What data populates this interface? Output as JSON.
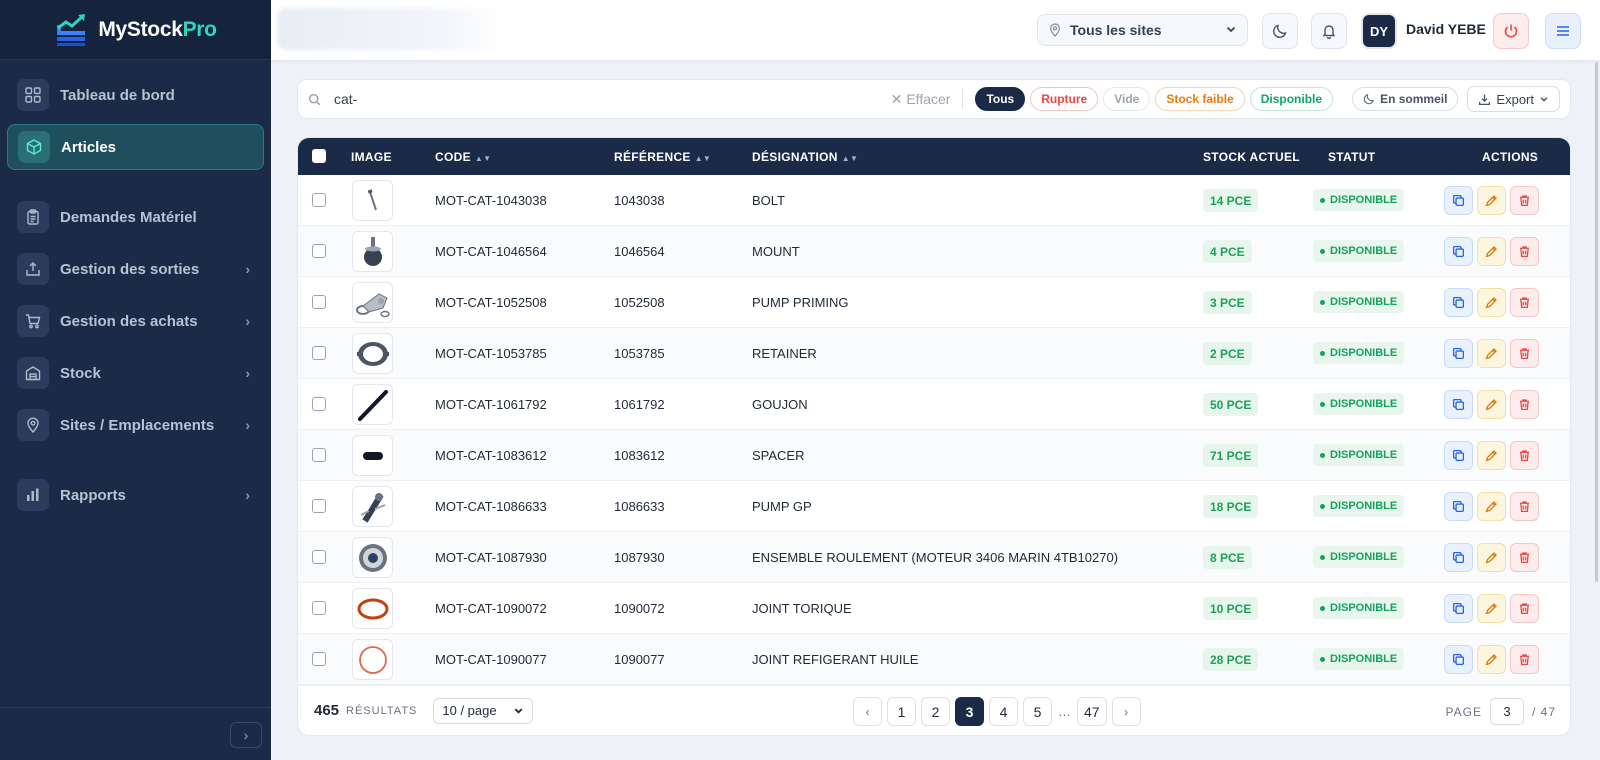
{
  "brand": {
    "name_main": "MyStock",
    "name_accent": "Pro"
  },
  "sidebar": {
    "items": [
      {
        "label": "Tableau de bord",
        "icon": "grid-icon",
        "has_chevron": false
      },
      {
        "label": "Articles",
        "icon": "cube-icon",
        "has_chevron": false,
        "active": true
      },
      {
        "label": "Demandes Matériel",
        "icon": "clipboard-icon",
        "has_chevron": false
      },
      {
        "label": "Gestion des sorties",
        "icon": "upload-icon",
        "has_chevron": true
      },
      {
        "label": "Gestion des achats",
        "icon": "cart-icon",
        "has_chevron": true
      },
      {
        "label": "Stock",
        "icon": "warehouse-icon",
        "has_chevron": true
      },
      {
        "label": "Sites / Emplacements",
        "icon": "map-pin-icon",
        "has_chevron": true
      },
      {
        "label": "Rapports",
        "icon": "bar-chart-icon",
        "has_chevron": true
      }
    ]
  },
  "topbar": {
    "site_select": "Tous les sites",
    "avatar_initials": "DY",
    "user_name": "David YEBE"
  },
  "filters": {
    "search_value": "cat-",
    "clear_label": "Effacer",
    "chips": [
      "Tous",
      "Rupture",
      "Vide",
      "Stock faible",
      "Disponible"
    ],
    "sleep_label": "En sommeil",
    "export_label": "Export"
  },
  "table": {
    "headers": {
      "image": "IMAGE",
      "code": "CODE",
      "reference": "RÉFÉRENCE",
      "designation": "DÉSIGNATION",
      "stock": "STOCK ACTUEL",
      "status": "STATUT",
      "actions": "ACTIONS"
    },
    "rows": [
      {
        "code": "MOT-CAT-1043038",
        "reference": "1043038",
        "designation": "BOLT",
        "stock": "14 PCE",
        "status": "DISPONIBLE",
        "image": "bolt"
      },
      {
        "code": "MOT-CAT-1046564",
        "reference": "1046564",
        "designation": "MOUNT",
        "stock": "4 PCE",
        "status": "DISPONIBLE",
        "image": "mount"
      },
      {
        "code": "MOT-CAT-1052508",
        "reference": "1052508",
        "designation": "PUMP PRIMING",
        "stock": "3 PCE",
        "status": "DISPONIBLE",
        "image": "pump"
      },
      {
        "code": "MOT-CAT-1053785",
        "reference": "1053785",
        "designation": "RETAINER",
        "stock": "2 PCE",
        "status": "DISPONIBLE",
        "image": "retainer"
      },
      {
        "code": "MOT-CAT-1061792",
        "reference": "1061792",
        "designation": "GOUJON",
        "stock": "50 PCE",
        "status": "DISPONIBLE",
        "image": "stud"
      },
      {
        "code": "MOT-CAT-1083612",
        "reference": "1083612",
        "designation": "SPACER",
        "stock": "71 PCE",
        "status": "DISPONIBLE",
        "image": "spacer"
      },
      {
        "code": "MOT-CAT-1086633",
        "reference": "1086633",
        "designation": "PUMP GP",
        "stock": "18 PCE",
        "status": "DISPONIBLE",
        "image": "pumpgp"
      },
      {
        "code": "MOT-CAT-1087930",
        "reference": "1087930",
        "designation": "ENSEMBLE ROULEMENT (MOTEUR 3406 MARIN 4TB10270)",
        "stock": "8 PCE",
        "status": "DISPONIBLE",
        "image": "bearing"
      },
      {
        "code": "MOT-CAT-1090072",
        "reference": "1090072",
        "designation": "JOINT TORIQUE",
        "stock": "10 PCE",
        "status": "DISPONIBLE",
        "image": "oring"
      },
      {
        "code": "MOT-CAT-1090077",
        "reference": "1090077",
        "designation": "JOINT REFIGERANT HUILE",
        "stock": "28 PCE",
        "status": "DISPONIBLE",
        "image": "seal"
      }
    ]
  },
  "footer": {
    "count": "465",
    "count_label": "RÉSULTATS",
    "per_page": "10 / page",
    "pages": [
      "1",
      "2",
      "3",
      "4",
      "5"
    ],
    "ellipsis": "…",
    "last_page": "47",
    "current_page": "3",
    "page_label": "PAGE",
    "page_total": "/ 47"
  },
  "colors": {
    "sidebar_bg": "#1b2a47",
    "accent": "#2dd4bf",
    "available": "#15a35c",
    "danger": "#ef4444",
    "warning": "#ea7b10"
  }
}
